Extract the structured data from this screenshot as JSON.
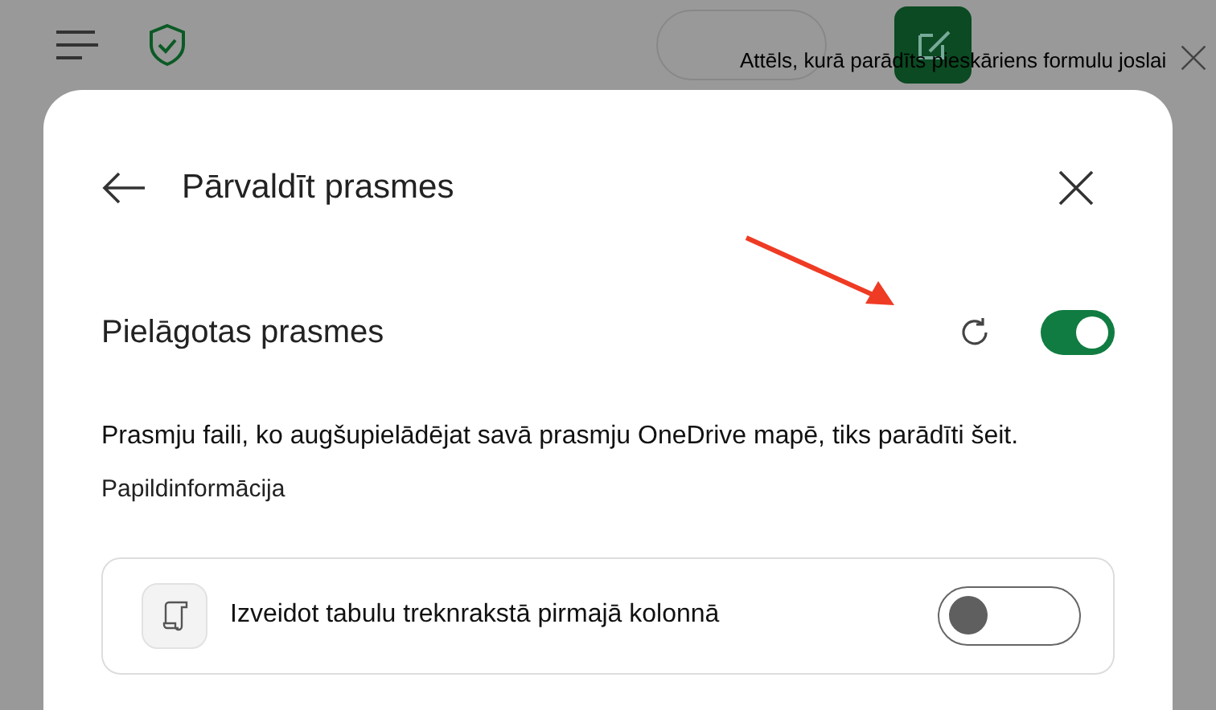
{
  "overlay_text": "Attēls, kurā parādīts pieskāriens formulu joslai",
  "dialog": {
    "title": "Pārvaldīt prasmes",
    "custom_skills": {
      "label": "Pielāgotas prasmes",
      "on": true
    },
    "description": "Prasmju faili, ko augšupielādējat savā prasmju OneDrive mapē, tiks parādīti šeit.",
    "link": "Papildinformācija",
    "skills": [
      {
        "label": "Izveidot tabulu treknrakstā pirmajā kolonnā",
        "on": false
      }
    ]
  }
}
